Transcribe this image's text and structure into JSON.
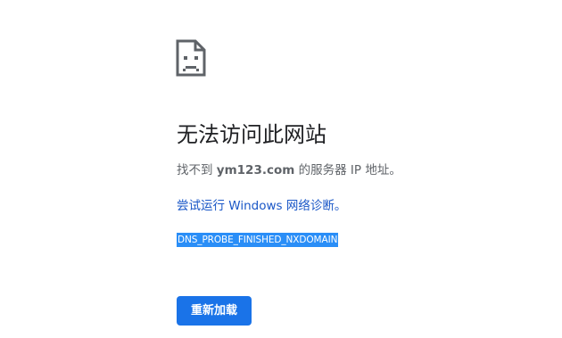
{
  "error_page": {
    "icon": "sad-page-icon",
    "title": "无法访问此网站",
    "message": {
      "prefix": "找不到 ",
      "host": "ym123.com",
      "suffix": " 的服务器 IP 地址。"
    },
    "suggestion_link": "尝试运行 Windows 网络诊断。",
    "error_code": "DNS_PROBE_FINISHED_NXDOMAIN",
    "reload_button_label": "重新加载"
  },
  "colors": {
    "title": "#202124",
    "body_text": "#5f6368",
    "link": "#1a57c7",
    "selection_highlight": "#2a8ef7",
    "button_bg": "#1a73e8"
  }
}
